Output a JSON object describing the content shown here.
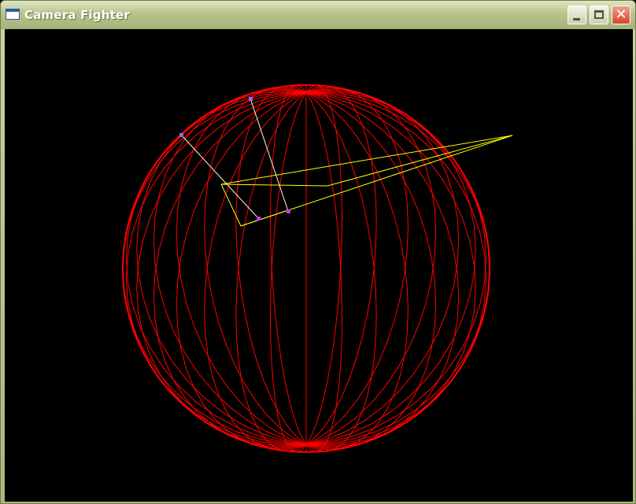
{
  "window": {
    "title": "Camera Fighter",
    "controls": {
      "minimize_icon": "minimize-icon",
      "maximize_icon": "maximize-icon",
      "close_icon": "close-icon",
      "close_glyph": "✕"
    }
  },
  "scene": {
    "background": "#000000",
    "sphere_color": "#ff0000",
    "camera_frustum_color": "#ffff00",
    "camera_ray_color": "#ffffcc",
    "marker_colors": [
      "#7f6fff",
      "#cc33ff"
    ]
  }
}
